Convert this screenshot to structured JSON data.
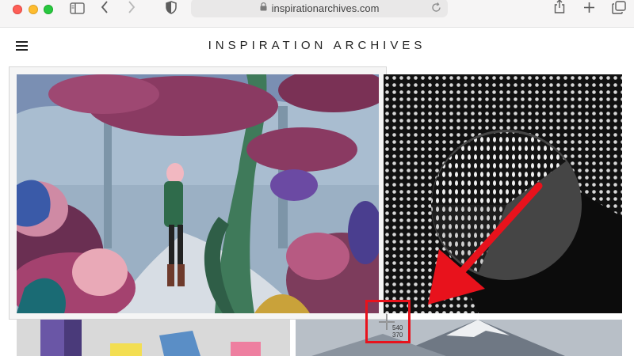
{
  "browser": {
    "url": "inspirationarchives.com",
    "icons": [
      "sidebar-icon",
      "back-icon",
      "forward-icon",
      "shield-icon",
      "lock-icon",
      "reload-icon",
      "share-icon",
      "new-tab-icon",
      "tabs-icon"
    ]
  },
  "site": {
    "title": "INSPIRATION ARCHIVES",
    "menu_icon": "hamburger-icon"
  },
  "gallery": {
    "items": [
      {
        "name": "forest illustration"
      },
      {
        "name": "halftone sphere"
      },
      {
        "name": "colored cubes"
      },
      {
        "name": "snowy mountain"
      }
    ]
  },
  "annotation": {
    "arrow_color": "#e8121c",
    "coord_x": "540",
    "coord_y": "370"
  }
}
